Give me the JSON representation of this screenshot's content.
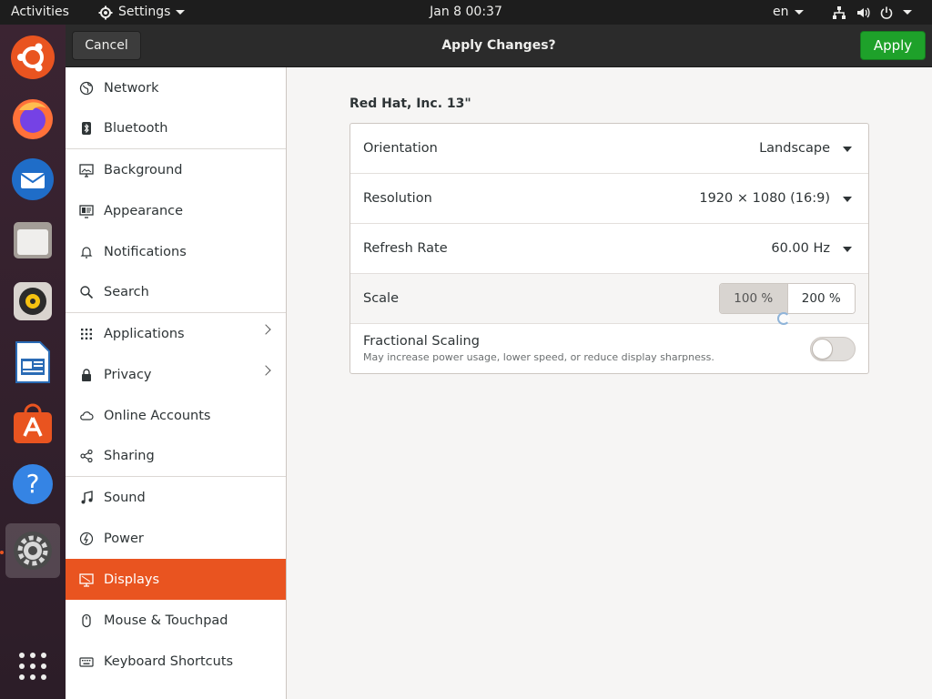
{
  "topbar": {
    "activities": "Activities",
    "app_menu": "Settings",
    "clock": "Jan 8  00:37",
    "language": "en",
    "icons": [
      "network-icon",
      "volume-icon",
      "power-icon"
    ]
  },
  "dock": {
    "items": [
      {
        "name": "ubuntu-icon",
        "running": false,
        "active": false
      },
      {
        "name": "firefox-icon",
        "running": false,
        "active": false
      },
      {
        "name": "thunderbird-icon",
        "running": false,
        "active": false
      },
      {
        "name": "files-icon",
        "running": false,
        "active": false
      },
      {
        "name": "rhythmbox-icon",
        "running": false,
        "active": false
      },
      {
        "name": "libreoffice-writer-icon",
        "running": false,
        "active": false
      },
      {
        "name": "software-icon",
        "running": false,
        "active": false
      },
      {
        "name": "help-icon",
        "running": false,
        "active": false
      },
      {
        "name": "settings-icon",
        "running": true,
        "active": true
      },
      {
        "name": "show-apps-icon",
        "running": false,
        "active": false
      }
    ]
  },
  "headerbar": {
    "cancel_label": "Cancel",
    "title": "Apply Changes?",
    "apply_label": "Apply"
  },
  "sidebar": {
    "items": [
      {
        "label": "Network",
        "icon": "network-icon"
      },
      {
        "label": "Bluetooth",
        "icon": "bluetooth-icon"
      },
      {
        "label": "Background",
        "icon": "background-icon"
      },
      {
        "label": "Appearance",
        "icon": "appearance-icon"
      },
      {
        "label": "Notifications",
        "icon": "notifications-icon"
      },
      {
        "label": "Search",
        "icon": "search-icon"
      },
      {
        "label": "Applications",
        "icon": "applications-icon"
      },
      {
        "label": "Privacy",
        "icon": "privacy-icon"
      },
      {
        "label": "Online Accounts",
        "icon": "online-accounts-icon"
      },
      {
        "label": "Sharing",
        "icon": "sharing-icon"
      },
      {
        "label": "Sound",
        "icon": "sound-icon"
      },
      {
        "label": "Power",
        "icon": "power-icon"
      },
      {
        "label": "Displays",
        "icon": "displays-icon",
        "selected": true
      },
      {
        "label": "Mouse & Touchpad",
        "icon": "mouse-icon"
      },
      {
        "label": "Keyboard Shortcuts",
        "icon": "keyboard-icon"
      }
    ]
  },
  "displays": {
    "monitor_name": "Red Hat, Inc. 13\"",
    "orientation": {
      "label": "Orientation",
      "value": "Landscape"
    },
    "resolution": {
      "label": "Resolution",
      "value": "1920 × 1080 (16:9)"
    },
    "refresh_rate": {
      "label": "Refresh Rate",
      "value": "60.00 Hz"
    },
    "scale": {
      "label": "Scale",
      "options": [
        "100 %",
        "200 %"
      ],
      "selected": "100 %"
    },
    "fractional_scaling": {
      "label": "Fractional Scaling",
      "description": "May increase power usage, lower speed, or reduce display sharpness.",
      "enabled": false
    }
  },
  "colors": {
    "accent": "#e95420",
    "apply_green": "#1ea12a",
    "topbar_bg": "#1d1d1d",
    "headerbar_bg": "#2b2b2b"
  }
}
